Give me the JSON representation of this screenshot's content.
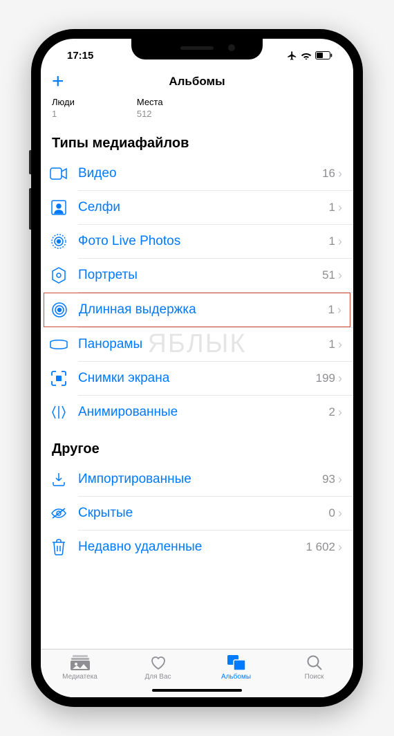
{
  "status": {
    "time": "17:15"
  },
  "nav": {
    "title": "Альбомы"
  },
  "top_albums": [
    {
      "label": "Люди",
      "count": "1"
    },
    {
      "label": "Места",
      "count": "512"
    }
  ],
  "sections": {
    "media_types": {
      "title": "Типы медиафайлов",
      "items": [
        {
          "label": "Видео",
          "count": "16"
        },
        {
          "label": "Селфи",
          "count": "1"
        },
        {
          "label": "Фото Live Photos",
          "count": "1"
        },
        {
          "label": "Портреты",
          "count": "51"
        },
        {
          "label": "Длинная выдержка",
          "count": "1"
        },
        {
          "label": "Панорамы",
          "count": "1"
        },
        {
          "label": "Снимки экрана",
          "count": "199"
        },
        {
          "label": "Анимированные",
          "count": "2"
        }
      ]
    },
    "other": {
      "title": "Другое",
      "items": [
        {
          "label": "Импортированные",
          "count": "93"
        },
        {
          "label": "Скрытые",
          "count": "0"
        },
        {
          "label": "Недавно удаленные",
          "count": "1 602"
        }
      ]
    }
  },
  "tabs": [
    {
      "label": "Медиатека"
    },
    {
      "label": "Для Вас"
    },
    {
      "label": "Альбомы"
    },
    {
      "label": "Поиск"
    }
  ],
  "watermark": "ЯБЛЫК"
}
